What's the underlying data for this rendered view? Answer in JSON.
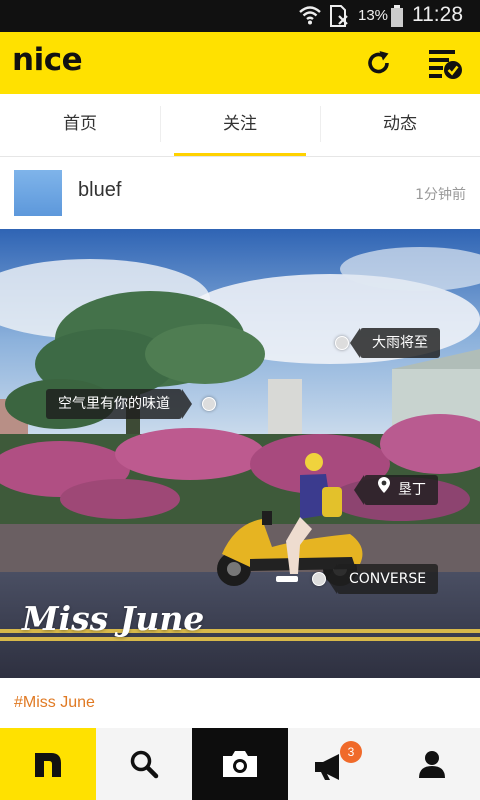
{
  "status_bar": {
    "battery_percent": "13%",
    "time": "11:28",
    "icons": [
      "wifi-icon",
      "no-sim-icon",
      "battery-icon"
    ]
  },
  "app": {
    "logo": "nice",
    "header_icons": [
      "refresh-icon",
      "checklist-icon"
    ],
    "brand_color": "#ffe100"
  },
  "tabs": [
    {
      "label": "首页",
      "active": false
    },
    {
      "label": "关注",
      "active": true
    },
    {
      "label": "动态",
      "active": false
    }
  ],
  "post": {
    "username": "bluef",
    "timestamp": "1分钟前",
    "signature": "Miss June",
    "hashtag": "#Miss June",
    "tags": [
      {
        "text": "大雨将至"
      },
      {
        "text": "空气里有你的味道"
      },
      {
        "text": "垦丁",
        "icon": "location-pin-icon"
      },
      {
        "text": "CONVERSE"
      }
    ]
  },
  "bottom_nav": {
    "items": [
      "home-icon",
      "search-icon",
      "camera-icon",
      "megaphone-icon",
      "profile-icon"
    ],
    "notification_badge": "3",
    "badge_color": "#f06a2a"
  }
}
